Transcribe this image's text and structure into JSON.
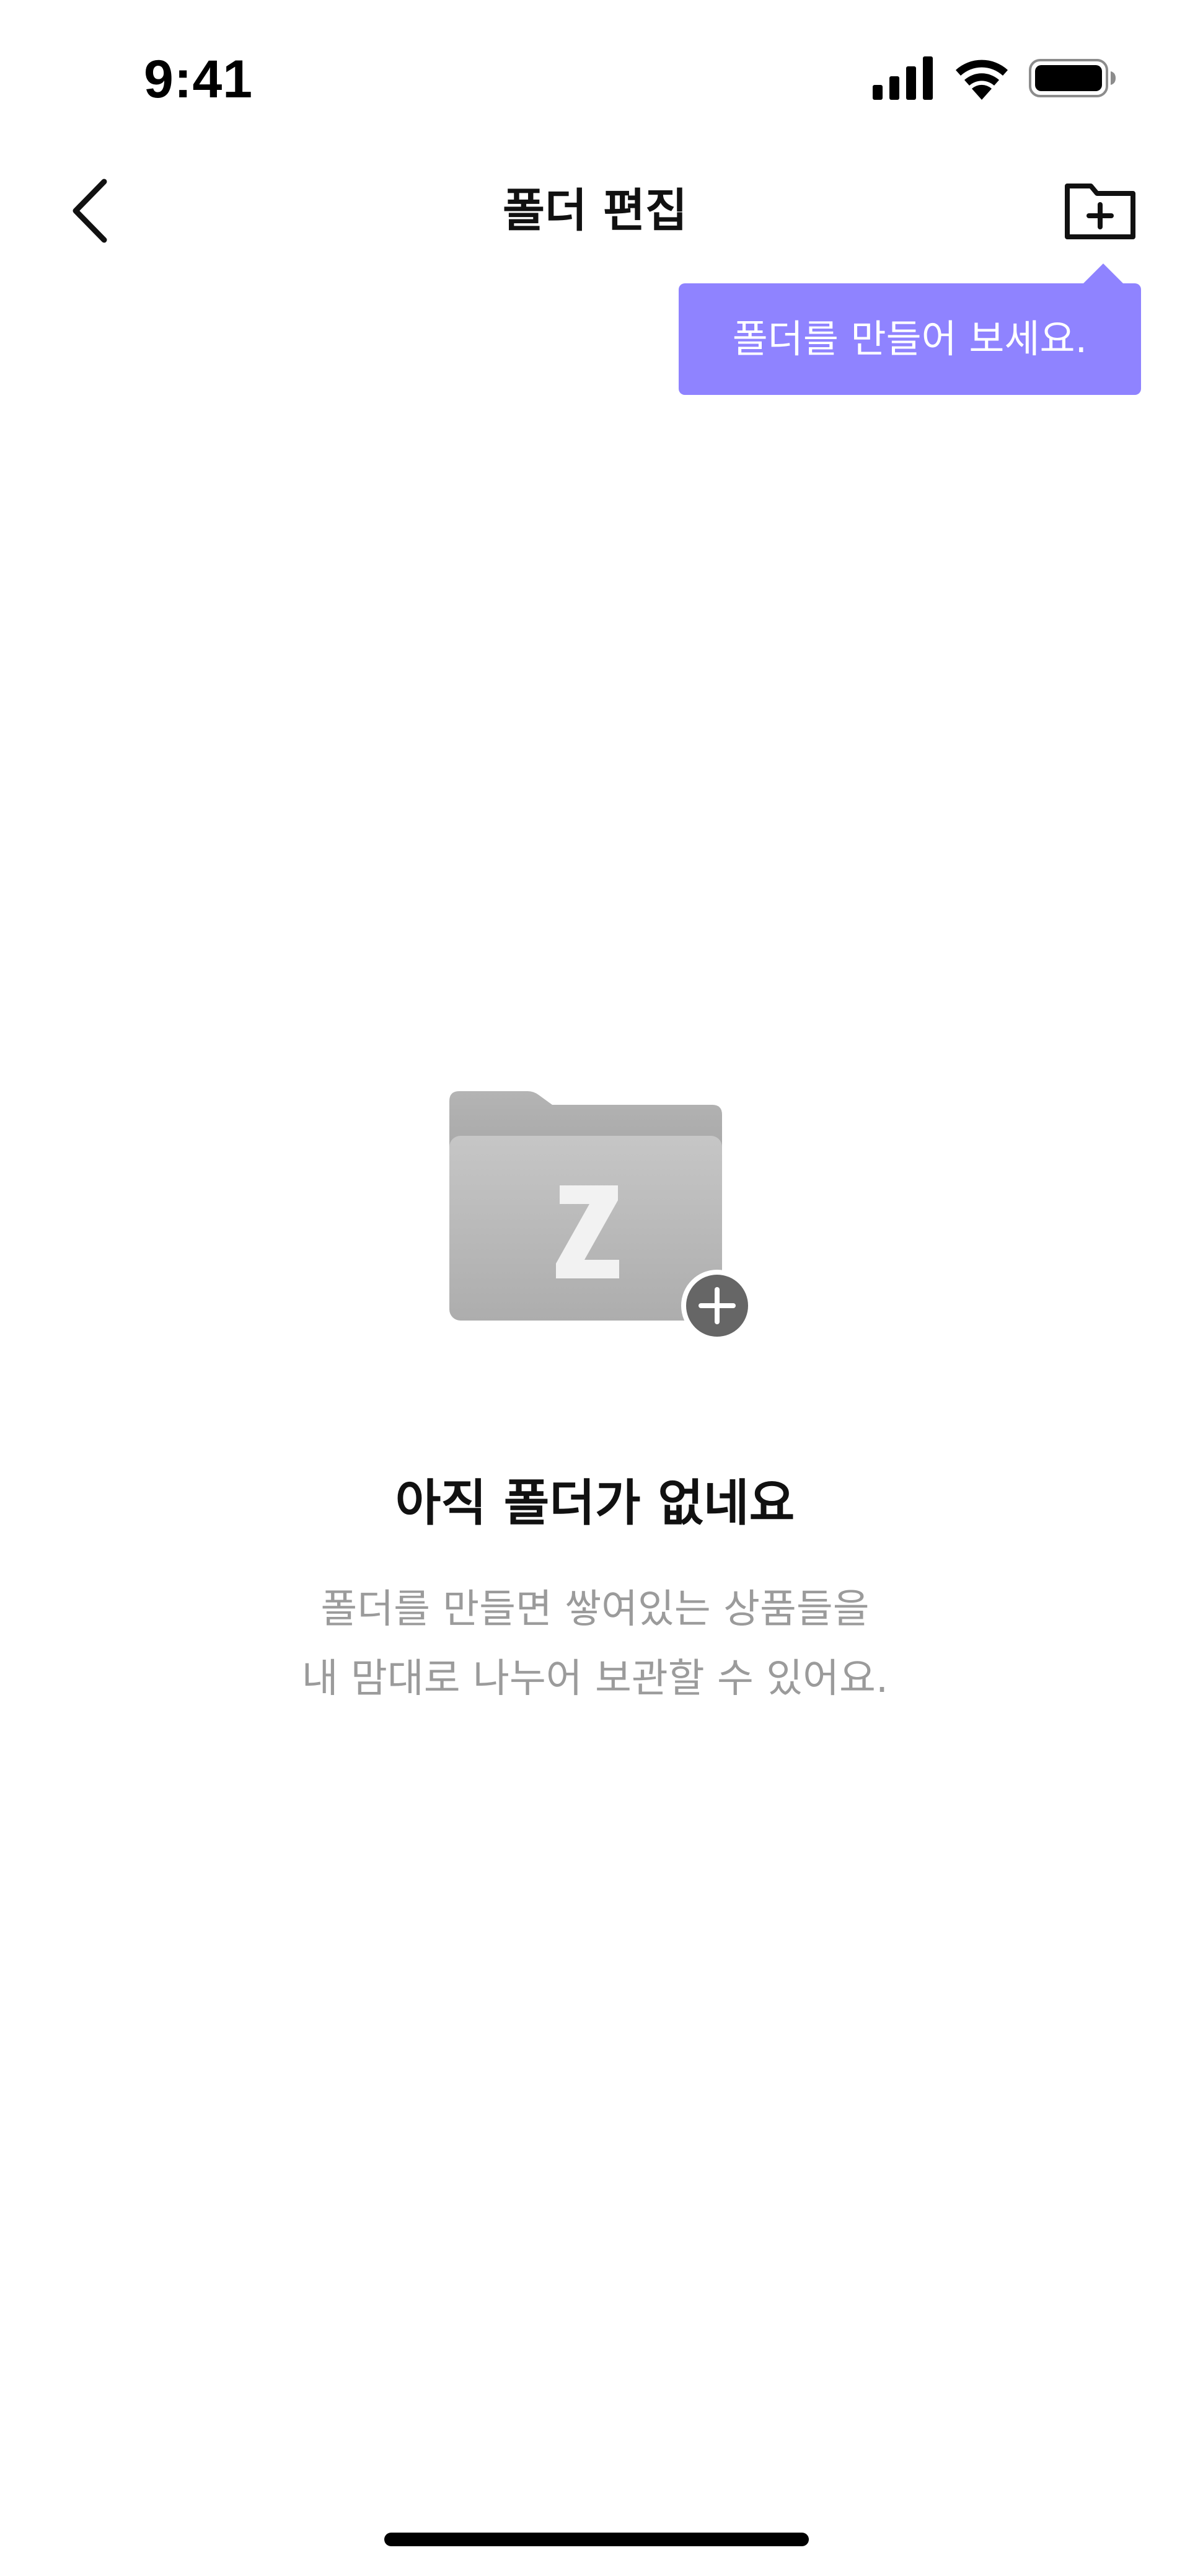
{
  "status_bar": {
    "time": "9:41",
    "icons": [
      "cellular-signal-icon",
      "wifi-icon",
      "battery-icon"
    ]
  },
  "header": {
    "title": "폴더 편집",
    "back_icon": "chevron-left-icon",
    "new_folder_icon": "folder-plus-icon"
  },
  "tooltip": {
    "text": "폴더를 만들어 보세요.",
    "color": "#8f83ff"
  },
  "empty_state": {
    "illustration_icon": "folder-z-plus-icon",
    "folder_letter": "Z",
    "title": "아직 폴더가 없네요",
    "desc_line1": "폴더를 만들면 쌓여있는 상품들을",
    "desc_line2": "내 맘대로 나누어 보관할 수 있어요."
  },
  "colors": {
    "accent": "#8f83ff",
    "text_primary": "#111111",
    "text_secondary": "#9b9b9b"
  }
}
